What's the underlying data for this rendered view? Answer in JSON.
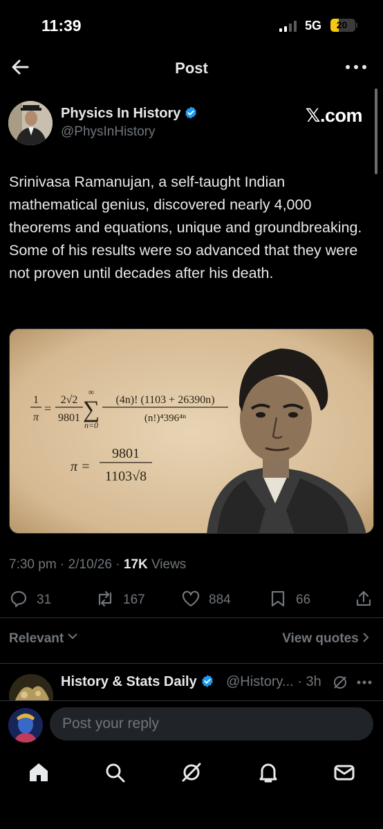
{
  "status_bar": {
    "time": "11:39",
    "network": "5G",
    "battery": "20",
    "battery_level_percent": 20
  },
  "header": {
    "title": "Post"
  },
  "post": {
    "author_name": "Physics In History",
    "author_handle": "@PhysInHistory",
    "watermark": "𝕏.com",
    "text": "Srinivasa Ramanujan, a self-taught Indian mathematical genius, discovered nearly 4,000 theorems and equations, unique and groundbreaking. Some of his results were so advanced that they were not proven until decades after his death.",
    "meta_time": "7:30 pm · 2/10/26 · ",
    "views_count": "17K",
    "views_label": " Views",
    "image_formulas": {
      "f1_lhs_num": "1",
      "f1_lhs_den": "π",
      "f1_eq": "=",
      "f1_coef_num": "2√2",
      "f1_coef_den": "9801",
      "sum_sym": "∑",
      "sum_top": "∞",
      "sum_bottom": "n=0",
      "f1_frac_num": "(4n)! (1103 + 26390n)",
      "f1_frac_den": "(n!)⁴396⁴ⁿ",
      "f2_lhs": "π =",
      "f2_num": "9801",
      "f2_den": "1103√8"
    },
    "actions": {
      "replies": "31",
      "reposts": "167",
      "likes": "884",
      "bookmarks": "66"
    }
  },
  "filters": {
    "sort_label": "Relevant",
    "view_quotes": "View quotes"
  },
  "reply_preview": {
    "name": "History & Stats Daily",
    "handle_time": "@History... · 3h"
  },
  "reply_bar": {
    "placeholder": "Post your reply"
  },
  "colors": {
    "background": "#000000",
    "text": "#e7e9ea",
    "muted": "#71767b",
    "verified": "#1d9bf0",
    "divider": "#2f3336"
  }
}
